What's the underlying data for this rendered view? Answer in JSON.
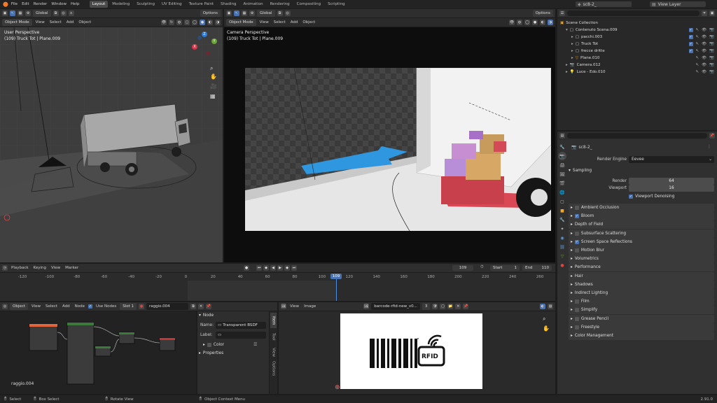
{
  "topbar": {
    "menus": [
      "File",
      "Edit",
      "Render",
      "Window",
      "Help"
    ],
    "workspaces": [
      "Layout",
      "Modeling",
      "Sculpting",
      "UV Editing",
      "Texture Paint",
      "Shading",
      "Animation",
      "Rendering",
      "Compositing",
      "Scripting"
    ],
    "active_workspace": "Layout",
    "scene_name": "sc8-2_",
    "view_layer": "View Layer"
  },
  "viewport_left": {
    "mode": "Object Mode",
    "menus": [
      "View",
      "Select",
      "Add",
      "Object"
    ],
    "orientation": "Global",
    "options": "Options",
    "title": "User Perspective",
    "subtitle": "(109) Truck Tot | Plane.009",
    "gizmo": {
      "x": "X",
      "y": "Y",
      "z": "Z"
    }
  },
  "viewport_right": {
    "mode": "Object Mode",
    "menus": [
      "View",
      "Select",
      "Add",
      "Object"
    ],
    "orientation": "Global",
    "options": "Options",
    "title": "Camera Perspective",
    "subtitle": "(109) Truck Tot | Plane.009"
  },
  "outliner": {
    "title": "Scene Collection",
    "items": [
      {
        "label": "Scene Collection",
        "indent": 0
      },
      {
        "label": "Contenuto Scena.009",
        "indent": 1
      },
      {
        "label": "pacchi.003",
        "indent": 2
      },
      {
        "label": "Truck Tot",
        "indent": 2
      },
      {
        "label": "frecce dritte",
        "indent": 2
      },
      {
        "label": "Plane.010",
        "indent": 2
      },
      {
        "label": "Camera.012",
        "indent": 1
      },
      {
        "label": "Luce - Edo.010",
        "indent": 1
      }
    ]
  },
  "properties": {
    "scene_name": "sc8-2_",
    "render_engine_label": "Render Engine",
    "render_engine": "Eevee",
    "sampling": "Sampling",
    "render_label": "Render",
    "render_value": "64",
    "viewport_label": "Viewport",
    "viewport_value": "16",
    "viewport_denoising": "Viewport Denoising",
    "panels": [
      "Ambient Occlusion",
      "Bloom",
      "Depth of Field",
      "Subsurface Scattering",
      "Screen Space Reflections",
      "Motion Blur",
      "Volumetrics",
      "Performance",
      "Hair",
      "Shadows",
      "Indirect Lighting",
      "Film",
      "Simplify",
      "Grease Pencil",
      "Freestyle",
      "Color Management"
    ]
  },
  "timeline": {
    "menus": [
      "Playback",
      "Keying",
      "View",
      "Marker"
    ],
    "current_frame": "109",
    "start_label": "Start",
    "start_value": "1",
    "end_label": "End",
    "end_value": "110",
    "ticks": [
      "-120",
      "-100",
      "-80",
      "-60",
      "-40",
      "-20",
      "0",
      "20",
      "40",
      "60",
      "80",
      "100",
      "120",
      "140",
      "160",
      "180",
      "200",
      "220",
      "240",
      "260"
    ]
  },
  "node_editor": {
    "type": "Object",
    "menus": [
      "View",
      "Select",
      "Add",
      "Node"
    ],
    "use_nodes": "Use Nodes",
    "slot": "Slot 1",
    "material": "raggio.004",
    "footer_material": "raggio.004",
    "sidebar": {
      "node_header": "Node",
      "name_label": "Name:",
      "name_value": "Transparent BSDF",
      "label_label": "Label:",
      "color_label": "Color",
      "properties_label": "Properties",
      "tabs": [
        "Item",
        "Tool",
        "View",
        "Options"
      ]
    }
  },
  "image_editor": {
    "menus": [
      "View",
      "Image"
    ],
    "image_name": "barcode-rfid-new_v0...",
    "users": "3",
    "image_text": "RFID"
  },
  "statusbar": {
    "select": "Select",
    "box_select": "Box Select",
    "rotate_view": "Rotate View",
    "context_menu": "Object Context Menu",
    "version": "2.91.0"
  }
}
